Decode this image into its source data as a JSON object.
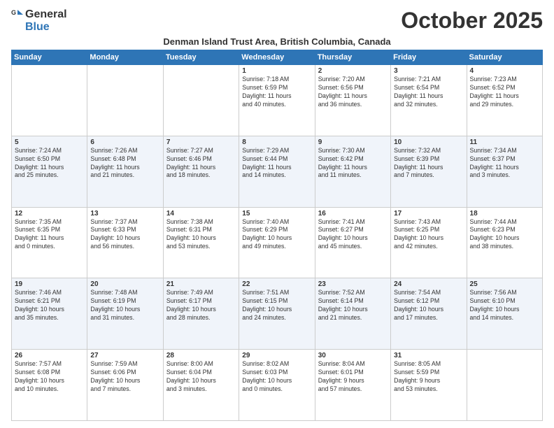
{
  "header": {
    "logo_general": "General",
    "logo_blue": "Blue",
    "month_title": "October 2025",
    "location": "Denman Island Trust Area, British Columbia, Canada"
  },
  "weekdays": [
    "Sunday",
    "Monday",
    "Tuesday",
    "Wednesday",
    "Thursday",
    "Friday",
    "Saturday"
  ],
  "weeks": [
    [
      {
        "day": "",
        "info": ""
      },
      {
        "day": "",
        "info": ""
      },
      {
        "day": "",
        "info": ""
      },
      {
        "day": "1",
        "info": "Sunrise: 7:18 AM\nSunset: 6:59 PM\nDaylight: 11 hours\nand 40 minutes."
      },
      {
        "day": "2",
        "info": "Sunrise: 7:20 AM\nSunset: 6:56 PM\nDaylight: 11 hours\nand 36 minutes."
      },
      {
        "day": "3",
        "info": "Sunrise: 7:21 AM\nSunset: 6:54 PM\nDaylight: 11 hours\nand 32 minutes."
      },
      {
        "day": "4",
        "info": "Sunrise: 7:23 AM\nSunset: 6:52 PM\nDaylight: 11 hours\nand 29 minutes."
      }
    ],
    [
      {
        "day": "5",
        "info": "Sunrise: 7:24 AM\nSunset: 6:50 PM\nDaylight: 11 hours\nand 25 minutes."
      },
      {
        "day": "6",
        "info": "Sunrise: 7:26 AM\nSunset: 6:48 PM\nDaylight: 11 hours\nand 21 minutes."
      },
      {
        "day": "7",
        "info": "Sunrise: 7:27 AM\nSunset: 6:46 PM\nDaylight: 11 hours\nand 18 minutes."
      },
      {
        "day": "8",
        "info": "Sunrise: 7:29 AM\nSunset: 6:44 PM\nDaylight: 11 hours\nand 14 minutes."
      },
      {
        "day": "9",
        "info": "Sunrise: 7:30 AM\nSunset: 6:42 PM\nDaylight: 11 hours\nand 11 minutes."
      },
      {
        "day": "10",
        "info": "Sunrise: 7:32 AM\nSunset: 6:39 PM\nDaylight: 11 hours\nand 7 minutes."
      },
      {
        "day": "11",
        "info": "Sunrise: 7:34 AM\nSunset: 6:37 PM\nDaylight: 11 hours\nand 3 minutes."
      }
    ],
    [
      {
        "day": "12",
        "info": "Sunrise: 7:35 AM\nSunset: 6:35 PM\nDaylight: 11 hours\nand 0 minutes."
      },
      {
        "day": "13",
        "info": "Sunrise: 7:37 AM\nSunset: 6:33 PM\nDaylight: 10 hours\nand 56 minutes."
      },
      {
        "day": "14",
        "info": "Sunrise: 7:38 AM\nSunset: 6:31 PM\nDaylight: 10 hours\nand 53 minutes."
      },
      {
        "day": "15",
        "info": "Sunrise: 7:40 AM\nSunset: 6:29 PM\nDaylight: 10 hours\nand 49 minutes."
      },
      {
        "day": "16",
        "info": "Sunrise: 7:41 AM\nSunset: 6:27 PM\nDaylight: 10 hours\nand 45 minutes."
      },
      {
        "day": "17",
        "info": "Sunrise: 7:43 AM\nSunset: 6:25 PM\nDaylight: 10 hours\nand 42 minutes."
      },
      {
        "day": "18",
        "info": "Sunrise: 7:44 AM\nSunset: 6:23 PM\nDaylight: 10 hours\nand 38 minutes."
      }
    ],
    [
      {
        "day": "19",
        "info": "Sunrise: 7:46 AM\nSunset: 6:21 PM\nDaylight: 10 hours\nand 35 minutes."
      },
      {
        "day": "20",
        "info": "Sunrise: 7:48 AM\nSunset: 6:19 PM\nDaylight: 10 hours\nand 31 minutes."
      },
      {
        "day": "21",
        "info": "Sunrise: 7:49 AM\nSunset: 6:17 PM\nDaylight: 10 hours\nand 28 minutes."
      },
      {
        "day": "22",
        "info": "Sunrise: 7:51 AM\nSunset: 6:15 PM\nDaylight: 10 hours\nand 24 minutes."
      },
      {
        "day": "23",
        "info": "Sunrise: 7:52 AM\nSunset: 6:14 PM\nDaylight: 10 hours\nand 21 minutes."
      },
      {
        "day": "24",
        "info": "Sunrise: 7:54 AM\nSunset: 6:12 PM\nDaylight: 10 hours\nand 17 minutes."
      },
      {
        "day": "25",
        "info": "Sunrise: 7:56 AM\nSunset: 6:10 PM\nDaylight: 10 hours\nand 14 minutes."
      }
    ],
    [
      {
        "day": "26",
        "info": "Sunrise: 7:57 AM\nSunset: 6:08 PM\nDaylight: 10 hours\nand 10 minutes."
      },
      {
        "day": "27",
        "info": "Sunrise: 7:59 AM\nSunset: 6:06 PM\nDaylight: 10 hours\nand 7 minutes."
      },
      {
        "day": "28",
        "info": "Sunrise: 8:00 AM\nSunset: 6:04 PM\nDaylight: 10 hours\nand 3 minutes."
      },
      {
        "day": "29",
        "info": "Sunrise: 8:02 AM\nSunset: 6:03 PM\nDaylight: 10 hours\nand 0 minutes."
      },
      {
        "day": "30",
        "info": "Sunrise: 8:04 AM\nSunset: 6:01 PM\nDaylight: 9 hours\nand 57 minutes."
      },
      {
        "day": "31",
        "info": "Sunrise: 8:05 AM\nSunset: 5:59 PM\nDaylight: 9 hours\nand 53 minutes."
      },
      {
        "day": "",
        "info": ""
      }
    ]
  ]
}
